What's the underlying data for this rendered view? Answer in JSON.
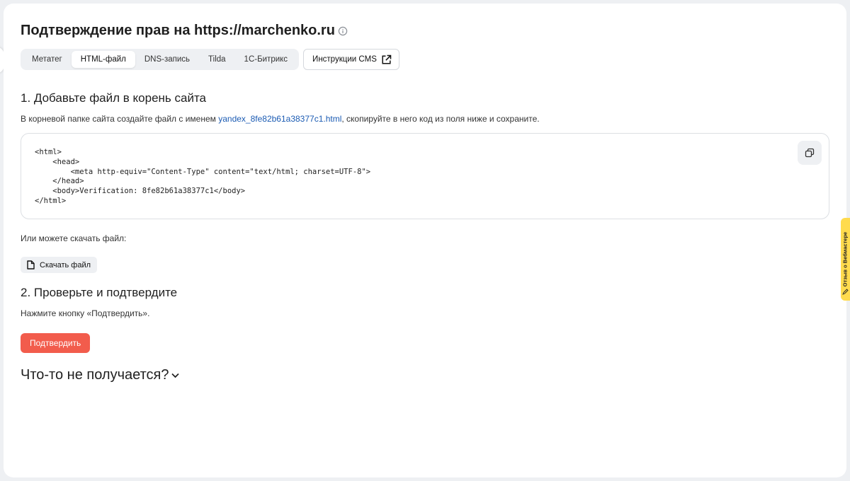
{
  "header": {
    "title": "Подтверждение прав на https://marchenko.ru"
  },
  "tabs": [
    {
      "label": "Метатег",
      "active": false
    },
    {
      "label": "HTML-файл",
      "active": true
    },
    {
      "label": "DNS-запись",
      "active": false
    },
    {
      "label": "Tilda",
      "active": false
    },
    {
      "label": "1С-Битрикс",
      "active": false
    }
  ],
  "cms_button": {
    "label": "Инструкции CMS"
  },
  "step1": {
    "title": "1. Добавьте файл в корень сайта",
    "desc_before": "В корневой папке сайта создайте файл с именем ",
    "filename": "yandex_8fe82b61a38377c1.html",
    "desc_after": ", скопируйте в него код из поля ниже и сохраните.",
    "code": "<html>\n    <head>\n        <meta http-equiv=\"Content-Type\" content=\"text/html; charset=UTF-8\">\n    </head>\n    <body>Verification: 8fe82b61a38377c1</body>\n</html>",
    "download_hint": "Или можете скачать файл:",
    "download_label": "Скачать файл"
  },
  "step2": {
    "title": "2. Проверьте и подтвердите",
    "desc": "Нажмите кнопку «Подтвердить».",
    "confirm_label": "Подтвердить"
  },
  "trouble": {
    "label": "Что-то не получается?"
  },
  "feedback": {
    "label": "Отзыв о Вебмастере"
  },
  "colors": {
    "accent": "#f25c4c",
    "link": "#1b5bb3",
    "feedback_bg": "#ffdb4d"
  },
  "icons": {
    "info": "info-circle-icon",
    "external": "external-link-icon",
    "copy": "copy-icon",
    "file": "file-icon",
    "chevron": "chevron-down-icon"
  }
}
